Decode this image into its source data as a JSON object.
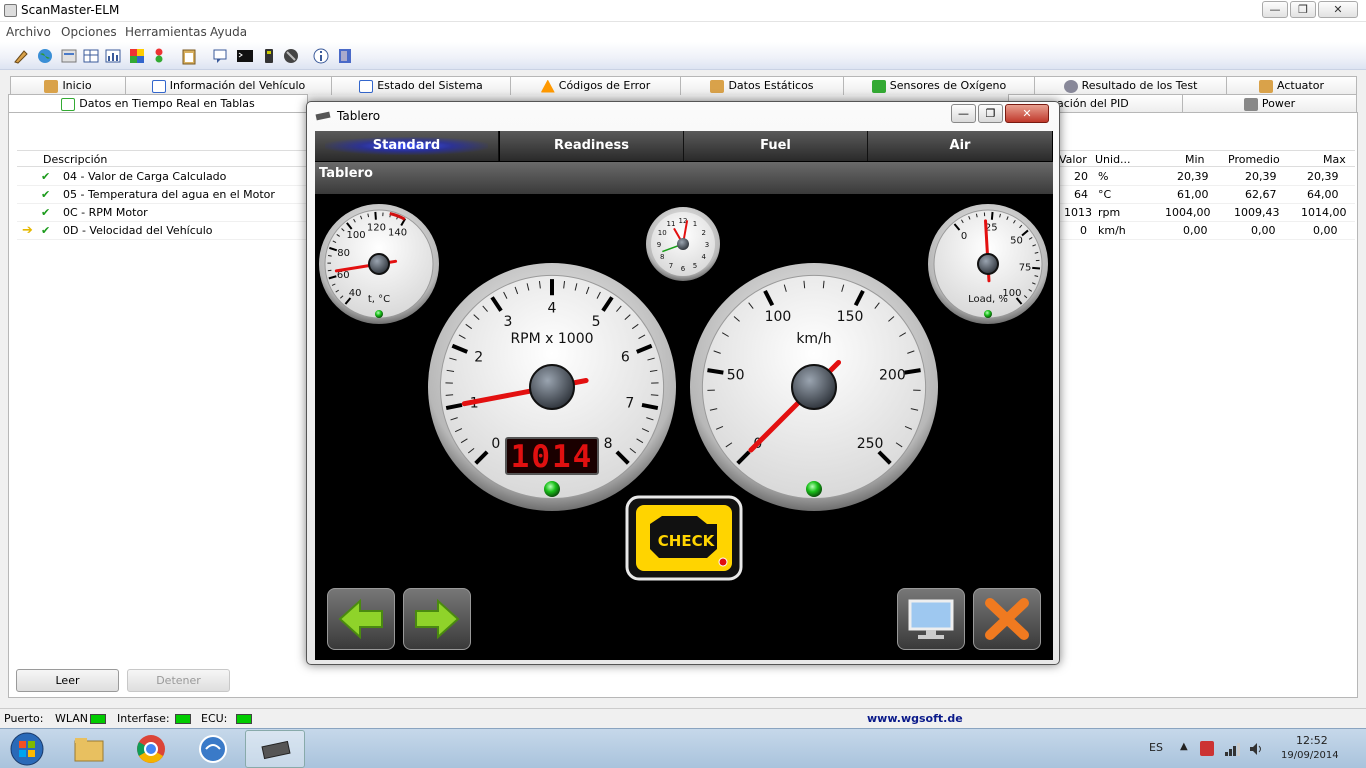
{
  "window": {
    "title": "ScanMaster-ELM",
    "min": "—",
    "max": "❐",
    "close": "✕"
  },
  "menu": [
    "Archivo",
    "Opciones",
    "Herramientas",
    "Ayuda"
  ],
  "tabs_row1": [
    "Inicio",
    "Información del Vehículo",
    "Estado del Sistema",
    "Códigos de Error",
    "Datos Estáticos",
    "Sensores de Oxígeno",
    "Resultado de los Test",
    "Actuator"
  ],
  "tabs_row2": {
    "active": "Datos en Tiempo Real en Tablas",
    "partial": "ación del PID",
    "power": "Power"
  },
  "grid": {
    "headers": {
      "desc": "Descripción",
      "valor": "Valor",
      "unid": "Unid...",
      "min": "Min",
      "prom": "Promedio",
      "max": "Max"
    },
    "rows": [
      {
        "desc": "04 - Valor de Carga Calculado",
        "valor": "20",
        "unid": "%",
        "min": "20,39",
        "prom": "20,39",
        "max": "20,39"
      },
      {
        "desc": "05 - Temperatura del agua en el Motor",
        "valor": "64",
        "unid": "°C",
        "min": "61,00",
        "prom": "62,67",
        "max": "64,00"
      },
      {
        "desc": "0C - RPM Motor",
        "valor": "1013",
        "unid": "rpm",
        "min": "1004,00",
        "prom": "1009,43",
        "max": "1014,00"
      },
      {
        "desc": "0D - Velocidad del Vehículo",
        "valor": "0",
        "unid": "km/h",
        "min": "0,00",
        "prom": "0,00",
        "max": "0,00"
      }
    ]
  },
  "buttons": {
    "read": "Leer",
    "stop": "Detener"
  },
  "status": {
    "port": "Puerto:",
    "wlan": "WLAN",
    "iface": "Interfase:",
    "ecu": "ECU:",
    "site": "www.wgsoft.de"
  },
  "taskbar": {
    "lang": "ES",
    "time": "12:52",
    "date": "19/09/2014"
  },
  "dialog": {
    "title": "Tablero",
    "segments": [
      "Standard",
      "Readiness",
      "Fuel",
      "Air"
    ],
    "section": "Tablero",
    "rpm_label": "RPM x 1000",
    "rpm_display": "1014",
    "speed_label": "km/h",
    "temp_label": "t, °C",
    "load_label": "Load, %",
    "check": "CHECK"
  },
  "gauges": {
    "rpm": {
      "ticks": [
        "0",
        "1",
        "2",
        "3",
        "4",
        "5",
        "6",
        "7",
        "8"
      ],
      "value_krpm": 1.014
    },
    "speed": {
      "ticks": [
        "0",
        "50",
        "100",
        "150",
        "200",
        "250"
      ],
      "value": 0
    },
    "temp": {
      "ticks": [
        "40",
        "60",
        "80",
        "100",
        "120",
        "140"
      ],
      "value": 64
    },
    "load": {
      "ticks": [
        "0",
        "25",
        "50",
        "75",
        "100"
      ],
      "value": 20.39
    }
  }
}
